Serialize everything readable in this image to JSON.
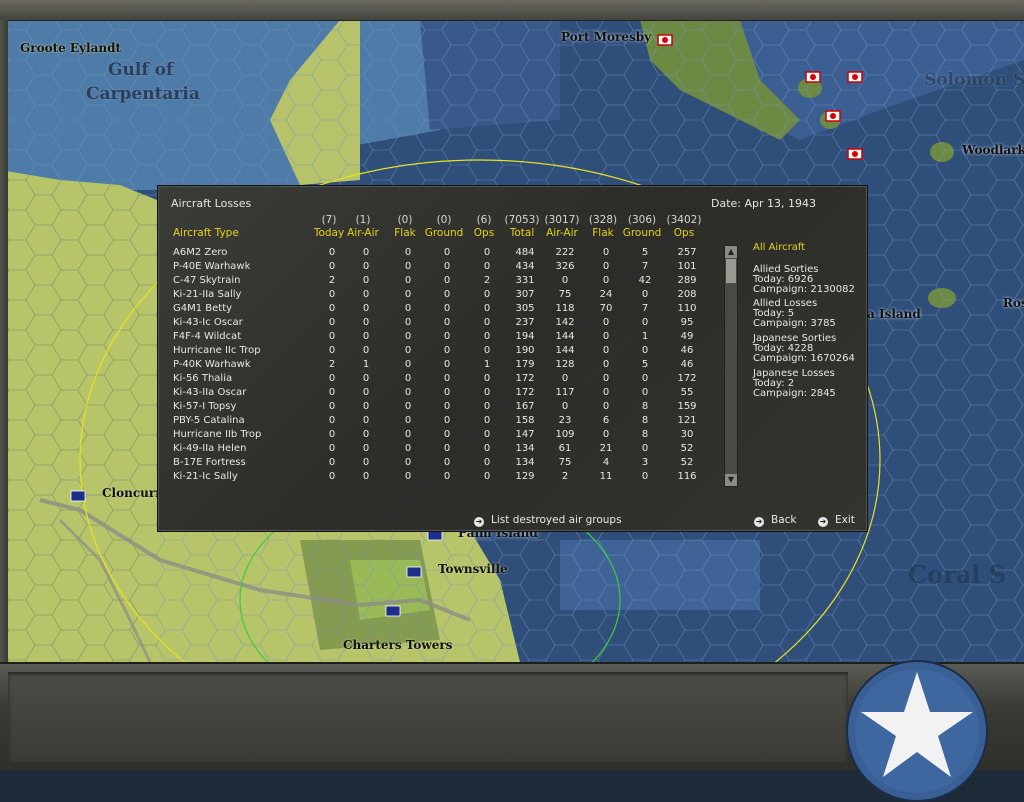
{
  "map_labels": {
    "groote_eylandt": "Groote Eylandt",
    "gulf_of": "Gulf of",
    "carpentaria": "Carpentaria",
    "port_moresby": "Port Moresby",
    "solomon_sea": "Solomon Se",
    "woodlark": "Woodlark",
    "a_island": "a Island",
    "ros": "Ros",
    "cloncurry": "Cloncurr",
    "palm_island": "Palm Island",
    "townsville": "Townsville",
    "charters_towers": "Charters Towers",
    "coral_sea": "Coral S"
  },
  "dialog": {
    "title": "Aircraft Losses",
    "date": "Date: Apr 13, 1943",
    "totals_row": [
      "(7)",
      "(1)",
      "(0)",
      "(0)",
      "(6)",
      "(7053)",
      "(3017)",
      "(328)",
      "(306)",
      "(3402)"
    ],
    "type_header": "Aircraft Type",
    "headers": [
      "Today",
      "Air-Air",
      "Flak",
      "Ground",
      "Ops",
      "Total",
      "Air-Air",
      "Flak",
      "Ground",
      "Ops"
    ],
    "rows": [
      {
        "name": "A6M2 Zero",
        "v": [
          "0",
          "0",
          "0",
          "0",
          "0",
          "484",
          "222",
          "0",
          "5",
          "257"
        ]
      },
      {
        "name": "P-40E Warhawk",
        "v": [
          "0",
          "0",
          "0",
          "0",
          "0",
          "434",
          "326",
          "0",
          "7",
          "101"
        ]
      },
      {
        "name": "C-47 Skytrain",
        "v": [
          "2",
          "0",
          "0",
          "0",
          "2",
          "331",
          "0",
          "0",
          "42",
          "289"
        ]
      },
      {
        "name": "Ki-21-IIa Sally",
        "v": [
          "0",
          "0",
          "0",
          "0",
          "0",
          "307",
          "75",
          "24",
          "0",
          "208"
        ]
      },
      {
        "name": "G4M1 Betty",
        "v": [
          "0",
          "0",
          "0",
          "0",
          "0",
          "305",
          "118",
          "70",
          "7",
          "110"
        ]
      },
      {
        "name": "Ki-43-Ic Oscar",
        "v": [
          "0",
          "0",
          "0",
          "0",
          "0",
          "237",
          "142",
          "0",
          "0",
          "95"
        ]
      },
      {
        "name": "F4F-4 Wildcat",
        "v": [
          "0",
          "0",
          "0",
          "0",
          "0",
          "194",
          "144",
          "0",
          "1",
          "49"
        ]
      },
      {
        "name": "Hurricane IIc Trop",
        "v": [
          "0",
          "0",
          "0",
          "0",
          "0",
          "190",
          "144",
          "0",
          "0",
          "46"
        ]
      },
      {
        "name": "P-40K Warhawk",
        "v": [
          "2",
          "1",
          "0",
          "0",
          "1",
          "179",
          "128",
          "0",
          "5",
          "46"
        ]
      },
      {
        "name": "Ki-56 Thalia",
        "v": [
          "0",
          "0",
          "0",
          "0",
          "0",
          "172",
          "0",
          "0",
          "0",
          "172"
        ]
      },
      {
        "name": "Ki-43-IIa Oscar",
        "v": [
          "0",
          "0",
          "0",
          "0",
          "0",
          "172",
          "117",
          "0",
          "0",
          "55"
        ]
      },
      {
        "name": "Ki-57-I Topsy",
        "v": [
          "0",
          "0",
          "0",
          "0",
          "0",
          "167",
          "0",
          "0",
          "8",
          "159"
        ]
      },
      {
        "name": "PBY-5 Catalina",
        "v": [
          "0",
          "0",
          "0",
          "0",
          "0",
          "158",
          "23",
          "6",
          "8",
          "121"
        ]
      },
      {
        "name": "Hurricane IIb Trop",
        "v": [
          "0",
          "0",
          "0",
          "0",
          "0",
          "147",
          "109",
          "0",
          "8",
          "30"
        ]
      },
      {
        "name": "Ki-49-IIa Helen",
        "v": [
          "0",
          "0",
          "0",
          "0",
          "0",
          "134",
          "61",
          "21",
          "0",
          "52"
        ]
      },
      {
        "name": "B-17E Fortress",
        "v": [
          "0",
          "0",
          "0",
          "0",
          "0",
          "134",
          "75",
          "4",
          "3",
          "52"
        ]
      },
      {
        "name": "Ki-21-Ic Sally",
        "v": [
          "0",
          "0",
          "0",
          "0",
          "0",
          "129",
          "2",
          "11",
          "0",
          "116"
        ]
      }
    ],
    "side": {
      "filter": "All Aircraft",
      "allied_sorties_title": "Allied Sorties",
      "allied_sorties_today": "Today:   6926",
      "allied_sorties_campaign": "Campaign: 2130082",
      "allied_losses_title": "Allied Losses",
      "allied_losses_today": "Today:   5",
      "allied_losses_campaign": "Campaign: 3785",
      "japanese_sorties_title": "Japanese Sorties",
      "japanese_sorties_today": "Today:   4228",
      "japanese_sorties_campaign": "Campaign: 1670264",
      "japanese_losses_title": "Japanese Losses",
      "japanese_losses_today": "Today:   2",
      "japanese_losses_campaign": "Campaign: 2845"
    },
    "buttons": {
      "list_destroyed": "List destroyed air groups",
      "back": "Back",
      "exit": "Exit"
    }
  },
  "colors": {
    "ocean_deep": "#2f4e7a",
    "ocean_shallow": "#4f7ba8",
    "land": "#b8c46a",
    "accent_yellow": "#e6d21e"
  }
}
